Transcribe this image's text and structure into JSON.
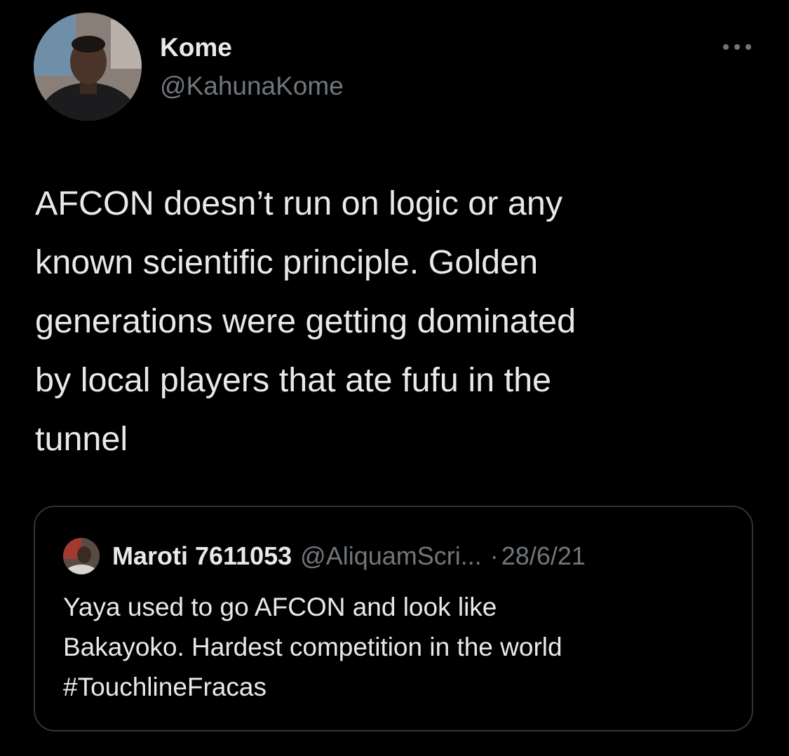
{
  "tweet": {
    "author_name": "Kome",
    "author_handle": "@KahunaKome",
    "more_icon": "more-dots-icon",
    "text": "AFCON doesn’t run on logic or any\nknown scientific principle. Golden\ngenerations were getting dominated\nby local players that ate fufu in the\ntunnel"
  },
  "quote": {
    "author_name": "Maroti 7611053",
    "author_handle": "@AliquamScri...",
    "separator": "·",
    "date": "28/6/21",
    "text": "Yaya used to go AFCON and look like\nBakayoko. Hardest competition in the world\n#TouchlineFracas"
  },
  "colors": {
    "background": "#000000",
    "primary_text": "#e7e9ea",
    "secondary_text": "#71767b",
    "border": "#2f3336"
  }
}
